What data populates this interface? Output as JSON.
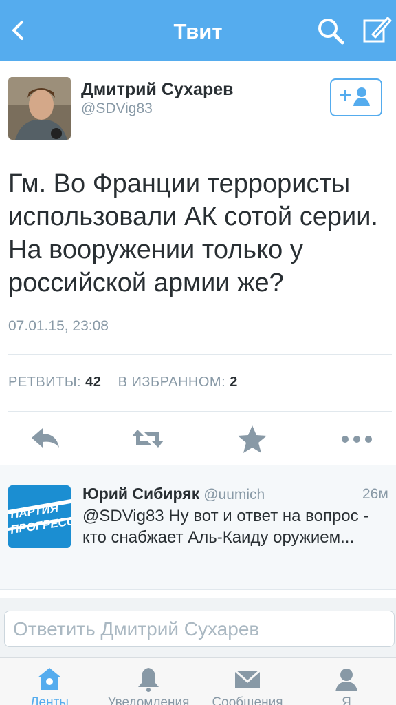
{
  "header": {
    "title": "Твит"
  },
  "tweet": {
    "author_name": "Дмитрий Сухарев",
    "author_handle": "@SDVig83",
    "text": "Гм. Во Франции террористы использовали АК сотой серии. На вооружении только у российской армии же?",
    "timestamp": "07.01.15, 23:08",
    "retweets_label": "РЕТВИТЫ:",
    "retweets_count": "42",
    "favorites_label": "В ИЗБРАННОМ:",
    "favorites_count": "2"
  },
  "reply": {
    "author_name": "Юрий Сибиряк",
    "author_handle": "@uumich",
    "time": "26м",
    "text": "@SDVig83 Ну вот и ответ на вопрос - кто снабжает Аль-Каиду оружием...",
    "avatar_text_line1": "ПАРТИЯ",
    "avatar_text_line2": "ПРОГРЕССА"
  },
  "compose": {
    "placeholder": "Ответить Дмитрий Сухарев"
  },
  "tabs": [
    {
      "label": "Ленты",
      "icon": "home-icon",
      "active": true
    },
    {
      "label": "Уведомления",
      "icon": "bell-icon",
      "active": false
    },
    {
      "label": "Сообщения",
      "icon": "envelope-icon",
      "active": false
    },
    {
      "label": "Я",
      "icon": "person-icon",
      "active": false
    }
  ],
  "colors": {
    "brand": "#55acee",
    "text": "#292f33",
    "muted": "#8899a6"
  }
}
